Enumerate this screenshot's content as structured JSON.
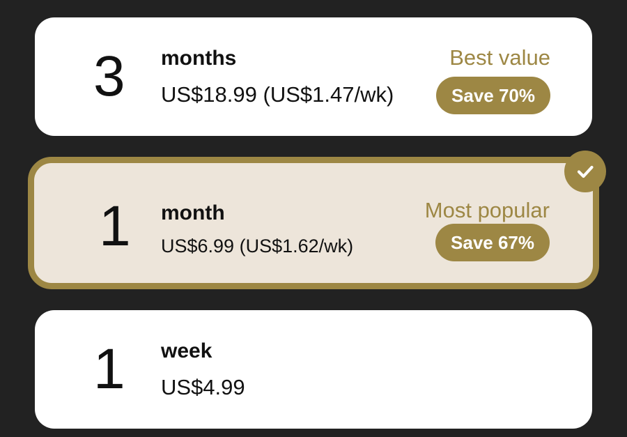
{
  "plans": [
    {
      "quantity": "3",
      "unit": "months",
      "price": "US$18.99 (US$1.47/wk)",
      "tag": "Best value",
      "save": "Save 70%",
      "selected": false
    },
    {
      "quantity": "1",
      "unit": "month",
      "price": "US$6.99 (US$1.62/wk)",
      "tag": "Most popular",
      "save": "Save 67%",
      "selected": true
    },
    {
      "quantity": "1",
      "unit": "week",
      "price": "US$4.99",
      "selected": false
    }
  ],
  "icons": {
    "selected_indicator": "checkmark-icon"
  },
  "colors": {
    "background": "#222222",
    "card": "#ffffff",
    "selected_card": "#ede5da",
    "accent_gold": "#9d8744",
    "text": "#111111"
  }
}
